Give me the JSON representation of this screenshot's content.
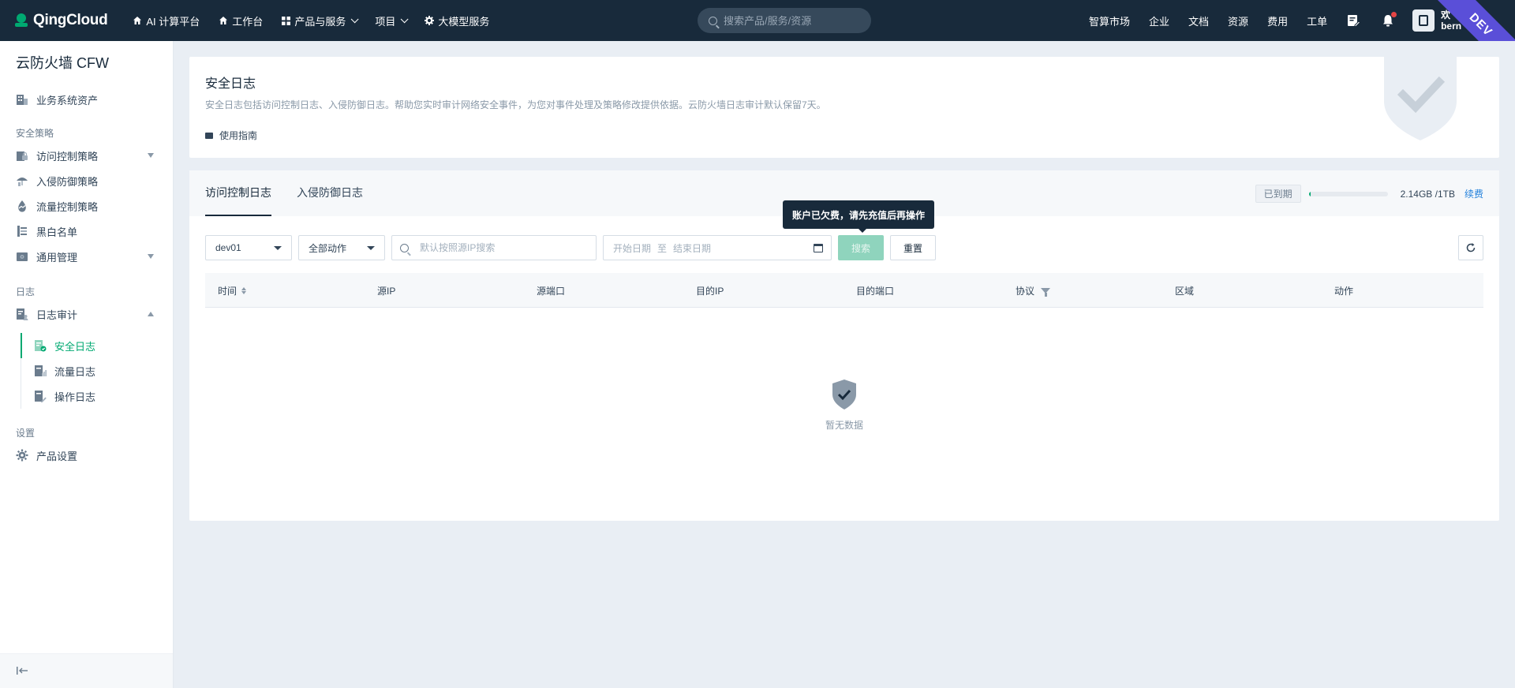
{
  "topbar": {
    "brand": "QingCloud",
    "nav": [
      {
        "icon": "house-icon",
        "label": "AI 计算平台"
      },
      {
        "icon": "house-icon",
        "label": "工作台"
      },
      {
        "icon": "grid-icon",
        "label": "产品与服务"
      },
      {
        "icon": "",
        "label": "项目"
      },
      {
        "icon": "gear-icon",
        "label": "大模型服务"
      }
    ],
    "search_placeholder": "搜索产品/服务/资源",
    "right_links": [
      "智算市场",
      "企业",
      "文档",
      "资源",
      "费用",
      "工单"
    ],
    "user_line1": "欢",
    "user_line2": "bern",
    "env_badge": "DEV"
  },
  "sidebar": {
    "title": "云防火墙 CFW",
    "assets_item": "业务系统资产",
    "group_security": "安全策略",
    "security_items": [
      "访问控制策略",
      "入侵防御策略",
      "流量控制策略",
      "黑白名单",
      "通用管理"
    ],
    "group_log": "日志",
    "log_audit": "日志审计",
    "log_sub": [
      "安全日志",
      "流量日志",
      "操作日志"
    ],
    "group_settings": "设置",
    "settings_item": "产品设置"
  },
  "intro": {
    "title": "安全日志",
    "description": "安全日志包括访问控制日志、入侵防御日志。帮助您实时审计网络安全事件，为您对事件处理及策略修改提供依据。云防火墙日志审计默认保留7天。",
    "guide_label": "使用指南"
  },
  "tabs": [
    "访问控制日志",
    "入侵防御日志"
  ],
  "quota": {
    "status": "已到期",
    "usage_fraction": 0.0021,
    "text": "2.14GB /1TB",
    "renew": "续费"
  },
  "filters": {
    "device": "dev01",
    "action": "全部动作",
    "ip_placeholder": "默认按照源IP搜索",
    "date_start": "开始日期",
    "date_sep": "至",
    "date_end": "结束日期",
    "search": "搜索",
    "reset": "重置",
    "tooltip": "账户已欠费，请先充值后再操作"
  },
  "table": {
    "columns": [
      "时间",
      "源IP",
      "源端口",
      "目的IP",
      "目的端口",
      "协议",
      "区域",
      "动作"
    ],
    "empty_text": "暂无数据"
  },
  "colors": {
    "brand_green": "#00a971",
    "topbar_bg": "#182a3b",
    "dev_purple": "#5a4fd8"
  }
}
